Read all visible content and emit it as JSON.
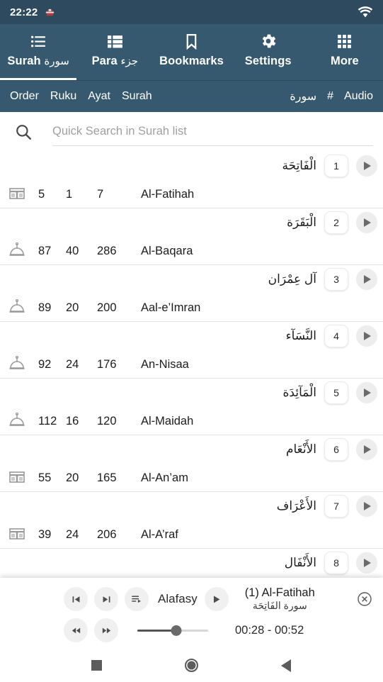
{
  "status_bar": {
    "time": "22:22",
    "notification_icon": "app-notification-icon",
    "wifi_icon": "wifi-icon"
  },
  "tabs": [
    {
      "label_en": "Surah",
      "label_ar": "سورة",
      "icon": "bulleted-list-icon",
      "active": true
    },
    {
      "label_en": "Para",
      "label_ar": "جزء",
      "icon": "table-list-icon",
      "active": false
    },
    {
      "label_en": "Bookmarks",
      "label_ar": "",
      "icon": "bookmark-icon",
      "active": false
    },
    {
      "label_en": "Settings",
      "label_ar": "",
      "icon": "gear-icon",
      "active": false
    },
    {
      "label_en": "More",
      "label_ar": "",
      "icon": "grid-apps-icon",
      "active": false
    }
  ],
  "column_header": {
    "left": [
      "Order",
      "Ruku",
      "Ayat",
      "Surah"
    ],
    "right": [
      "سورة",
      "#",
      "Audio"
    ]
  },
  "search": {
    "placeholder": "Quick Search in Surah list",
    "value": "",
    "icon": "search-icon"
  },
  "surah_rows": [
    {
      "number": "1",
      "arabic": "الْفَاتِحَة",
      "order": "5",
      "ruku": "1",
      "ayat": "7",
      "name": "Al-Fatihah",
      "place_icon": "kaaba-icon"
    },
    {
      "number": "2",
      "arabic": "الْبَقَرَة",
      "order": "87",
      "ruku": "40",
      "ayat": "286",
      "name": "Al-Baqara",
      "place_icon": "dome-icon"
    },
    {
      "number": "3",
      "arabic": "آل عِمْرَان",
      "order": "89",
      "ruku": "20",
      "ayat": "200",
      "name": "Aal-e’Imran",
      "place_icon": "dome-icon"
    },
    {
      "number": "4",
      "arabic": "النَّسَآء",
      "order": "92",
      "ruku": "24",
      "ayat": "176",
      "name": "An-Nisaa",
      "place_icon": "dome-icon"
    },
    {
      "number": "5",
      "arabic": "الْمَآئِدَة",
      "order": "112",
      "ruku": "16",
      "ayat": "120",
      "name": "Al-Maidah",
      "place_icon": "dome-icon"
    },
    {
      "number": "6",
      "arabic": "الأَنْعَام",
      "order": "55",
      "ruku": "20",
      "ayat": "165",
      "name": "Al-An’am",
      "place_icon": "kaaba-icon"
    },
    {
      "number": "7",
      "arabic": "الأَعْرَاف",
      "order": "39",
      "ruku": "24",
      "ayat": "206",
      "name": "Al-A’raf",
      "place_icon": "kaaba-icon"
    },
    {
      "number": "8",
      "arabic": "الأَنْفَال",
      "order": "",
      "ruku": "",
      "ayat": "",
      "name": "",
      "place_icon": ""
    }
  ],
  "player": {
    "prev_icon": "skip-previous-icon",
    "next_icon": "skip-next-icon",
    "playlist_icon": "playlist-play-icon",
    "reciter": "Alafasy",
    "play_icon": "play-icon",
    "track_title": "(1) Al-Fatihah",
    "track_title_arabic": "سورة الفَاتِحَة",
    "close_icon": "close-circle-icon",
    "rewind_icon": "rewind-icon",
    "forward_icon": "fast-forward-icon",
    "progress_percent": 55,
    "time_label": "00:28 - 00:52"
  },
  "nav_bar": {
    "recents_icon": "recents-square-icon",
    "home_icon": "home-circle-icon",
    "back_icon": "back-triangle-icon"
  },
  "colors": {
    "toolbar": "#37596f",
    "statusbar": "#2e4a5e",
    "accent": "#ffffff",
    "divider": "#e3e3e3"
  }
}
